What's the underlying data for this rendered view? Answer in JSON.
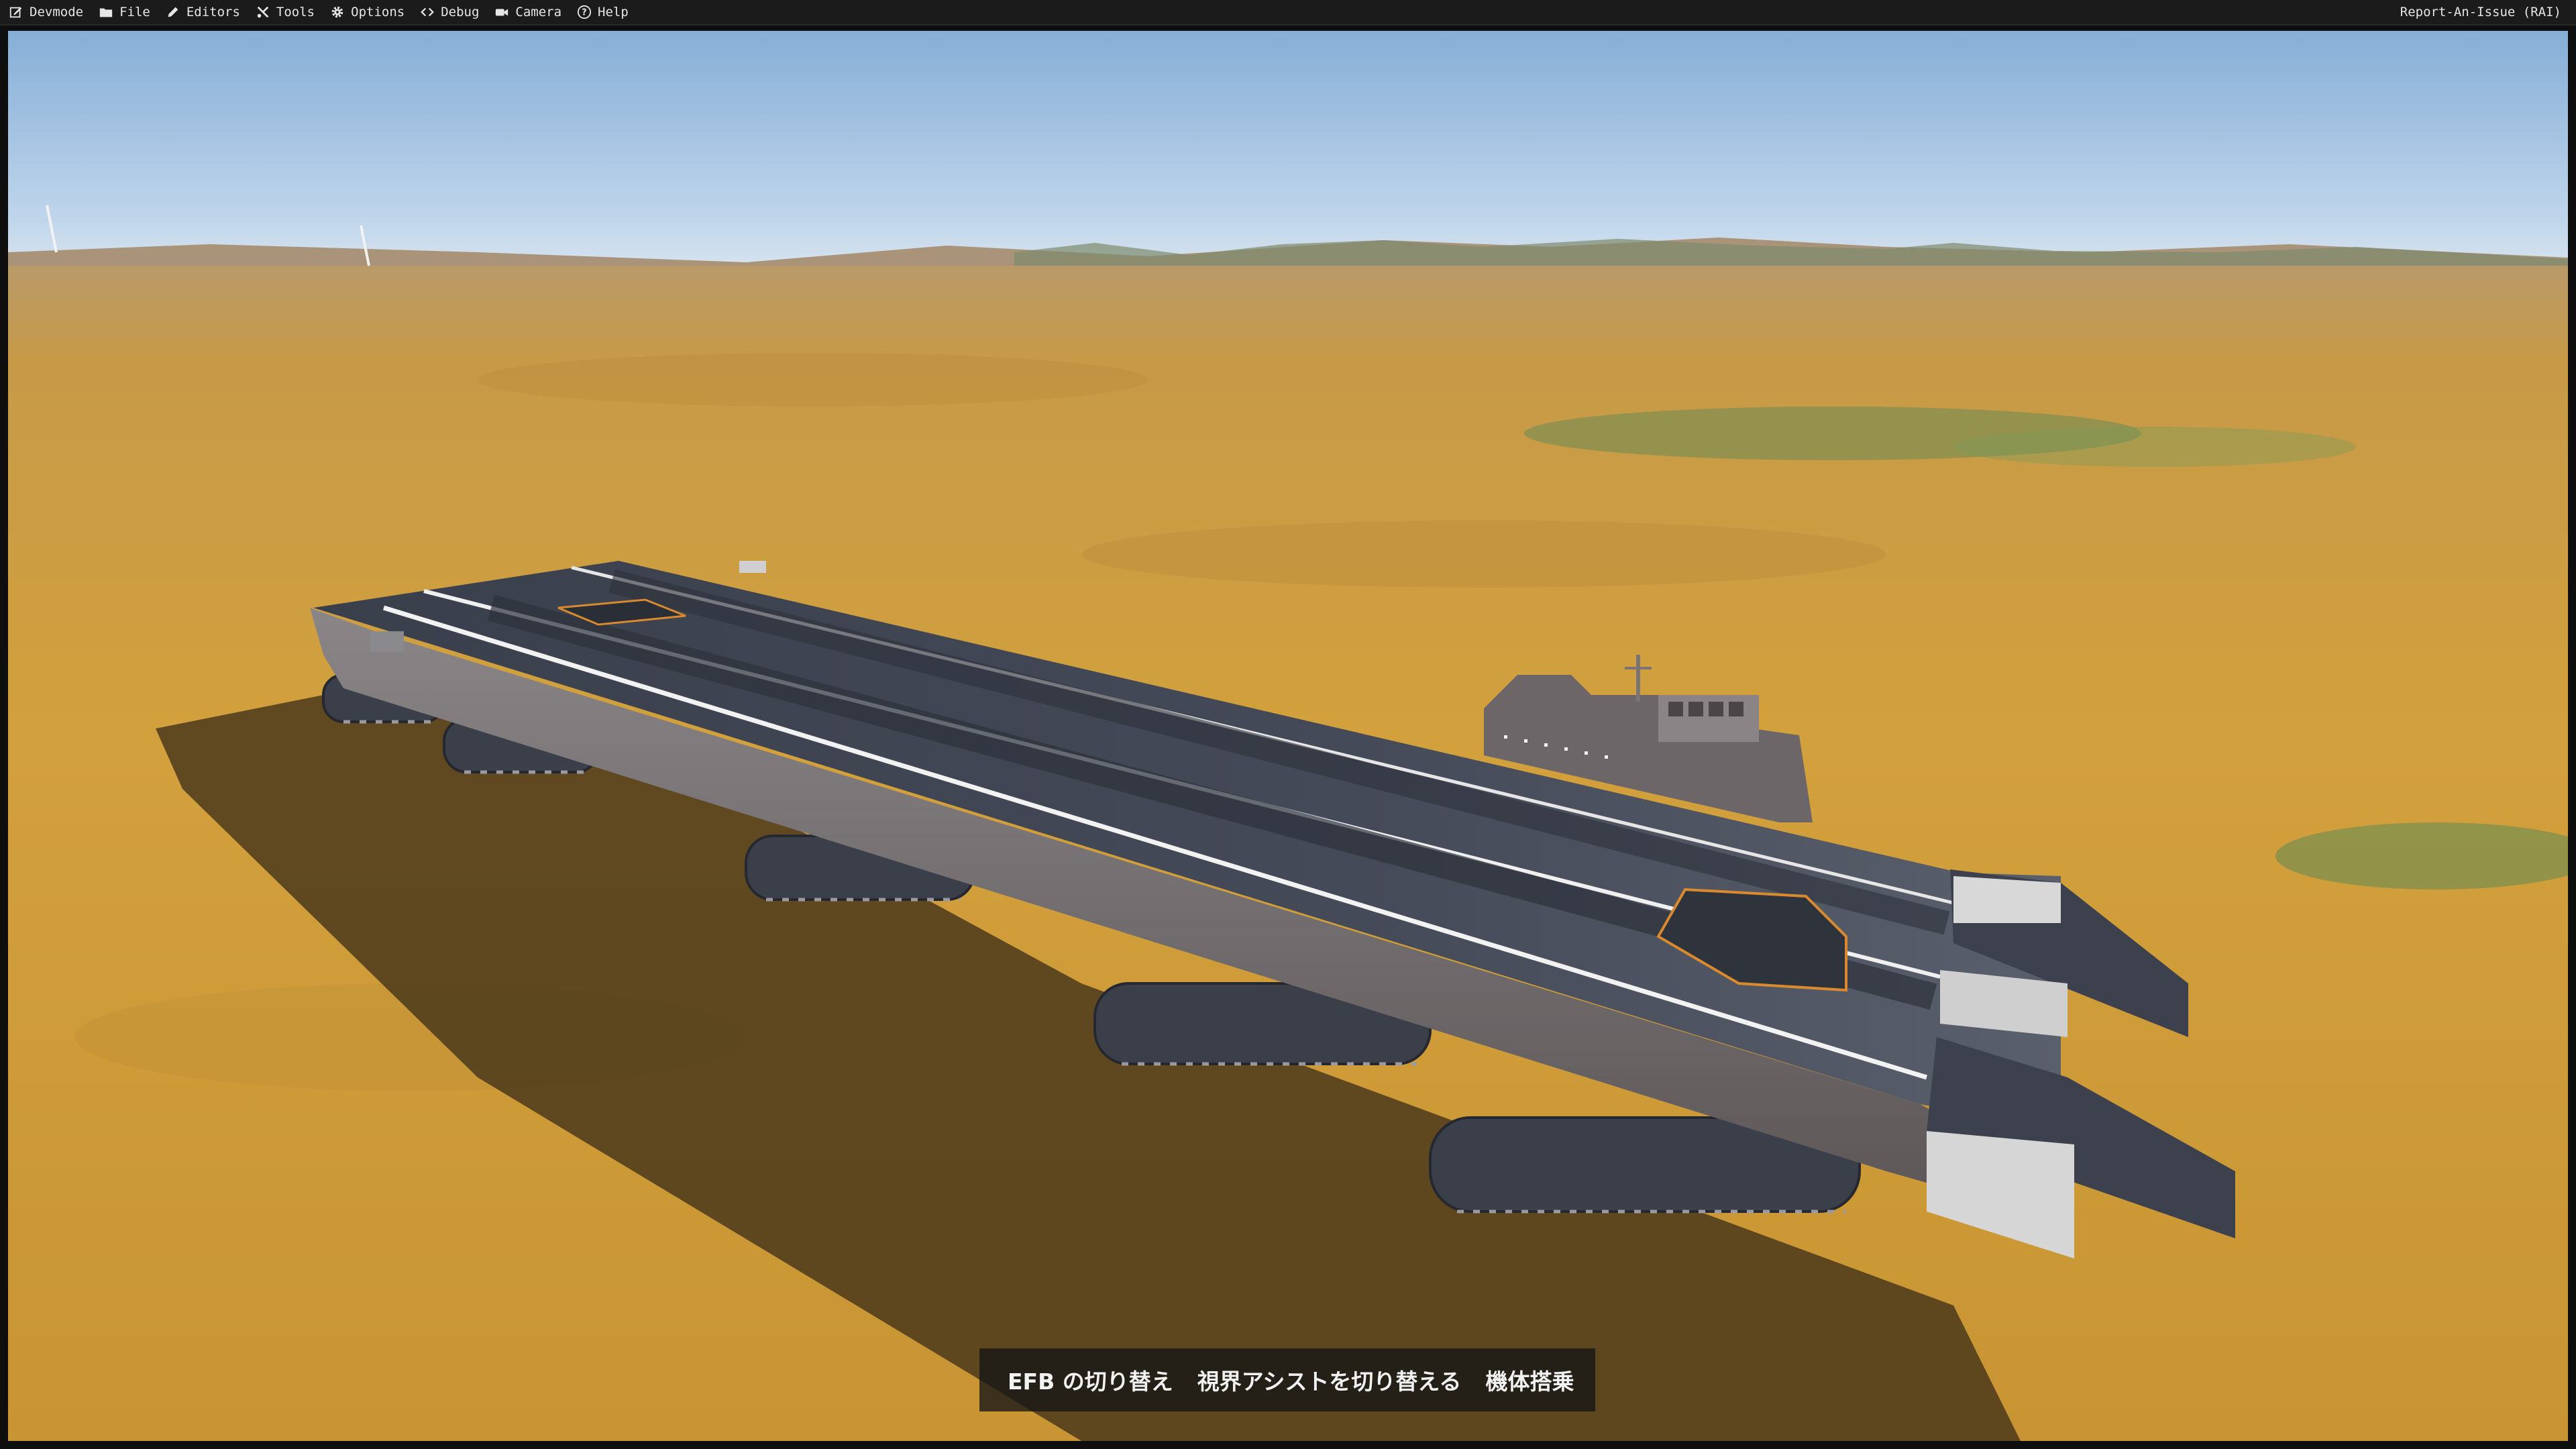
{
  "menubar": {
    "items": [
      {
        "label": "Devmode",
        "icon": "devmode-icon"
      },
      {
        "label": "File",
        "icon": "folder-icon"
      },
      {
        "label": "Editors",
        "icon": "pencil-icon"
      },
      {
        "label": "Tools",
        "icon": "tools-icon"
      },
      {
        "label": "Options",
        "icon": "gear-icon"
      },
      {
        "label": "Debug",
        "icon": "code-icon"
      },
      {
        "label": "Camera",
        "icon": "camera-icon"
      },
      {
        "label": "Help",
        "icon": "help-icon"
      }
    ],
    "right_label": "Report-An-Issue (RAI)"
  },
  "hints": {
    "efb": "EFB の切り替え",
    "visual_assist": "視界アシストを切り替える",
    "board": "機体搭乗"
  },
  "colors": {
    "menubar_bg": "#1b1b1b",
    "sky_top": "#8fb4d8",
    "desert": "#c8973a",
    "deck": "#3c4150"
  }
}
